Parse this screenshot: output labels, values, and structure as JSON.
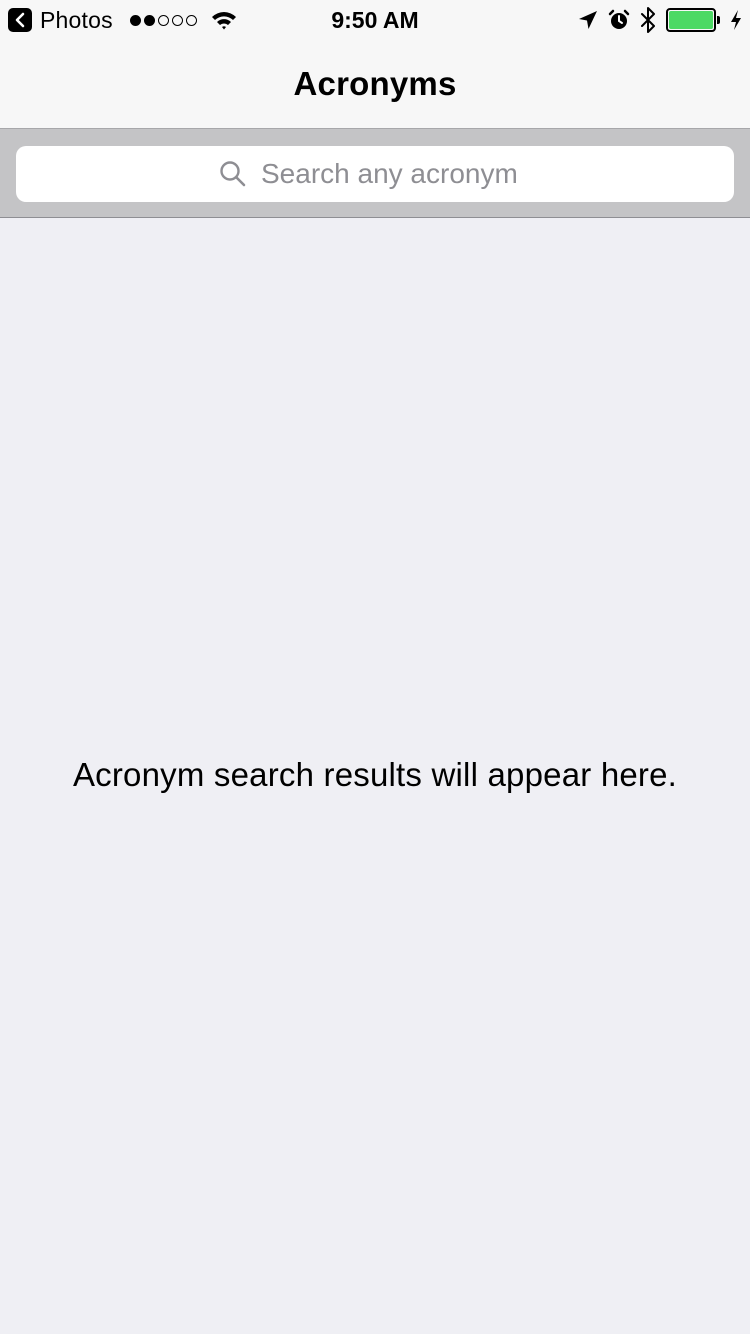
{
  "status_bar": {
    "back_app_label": "Photos",
    "time": "9:50 AM",
    "signal": {
      "bars_filled": 2,
      "bars_total": 5
    },
    "battery_level": 1.0,
    "icons": [
      "back-chevron-icon",
      "signal-dots-icon",
      "wifi-icon",
      "location-arrow-icon",
      "alarm-clock-icon",
      "bluetooth-icon",
      "battery-icon",
      "charging-bolt-icon"
    ]
  },
  "nav": {
    "title": "Acronyms"
  },
  "search": {
    "placeholder": "Search any acronym",
    "value": "",
    "icon": "search-icon"
  },
  "content": {
    "empty_message": "Acronym search results will appear here."
  },
  "colors": {
    "bar_background": "#f7f7f7",
    "search_bar_background": "#c4c4c6",
    "content_background": "#efeff4",
    "battery_fill": "#4cd964",
    "placeholder": "#8e8e93"
  }
}
